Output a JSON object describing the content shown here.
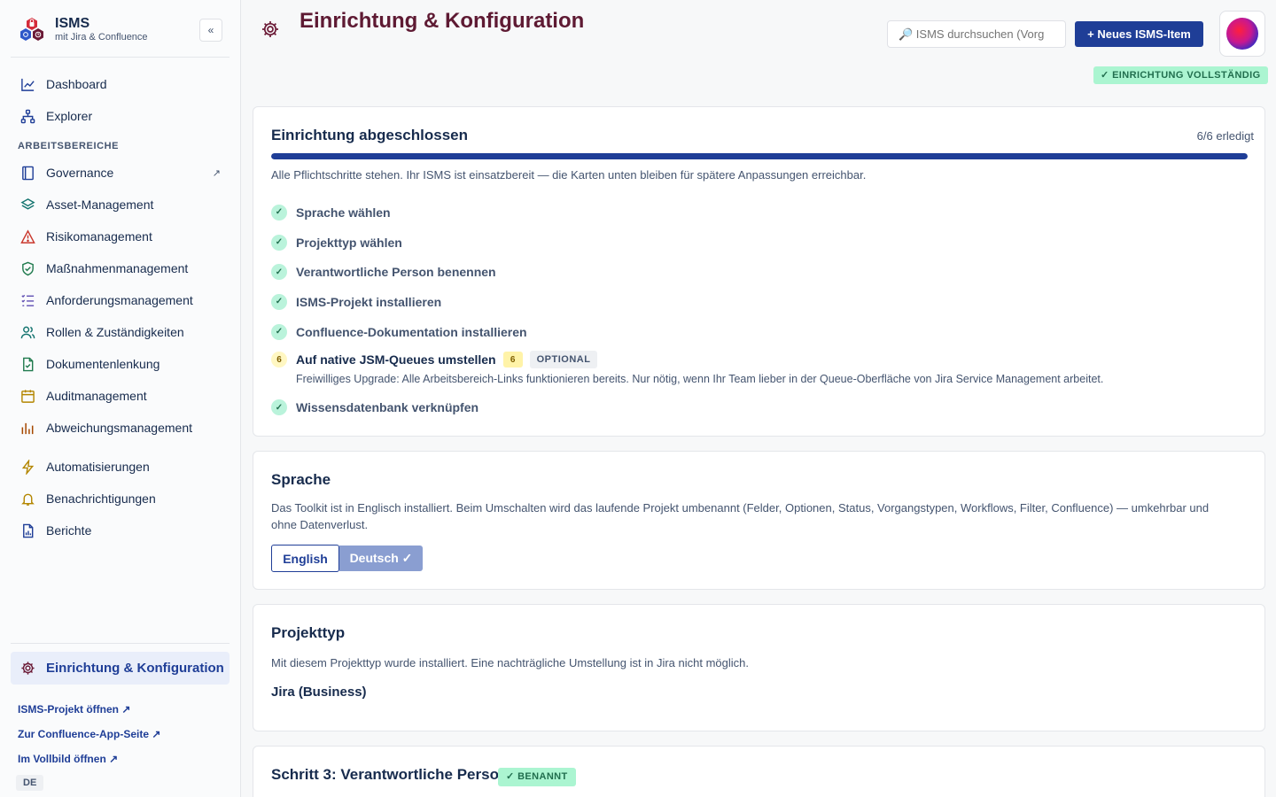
{
  "sidebar": {
    "brand_title": "ISMS",
    "brand_subtitle": "mit Jira & Confluence",
    "collapse_label": "«",
    "top_items": [
      {
        "label": "Dashboard",
        "icon": "chart-line-icon"
      },
      {
        "label": "Explorer",
        "icon": "hierarchy-icon"
      }
    ],
    "section_label": "ARBEITSBEREICHE",
    "items": [
      {
        "label": "Governance",
        "icon": "book-icon",
        "external": "↗"
      },
      {
        "label": "Asset-Management",
        "icon": "layers-icon"
      },
      {
        "label": "Risikomanagement",
        "icon": "warning-icon"
      },
      {
        "label": "Maßnahmenmanagement",
        "icon": "shield-check-icon"
      },
      {
        "label": "Anforderungsmanagement",
        "icon": "checklist-icon"
      },
      {
        "label": "Rollen & Zuständigkeiten",
        "icon": "users-icon"
      },
      {
        "label": "Dokumentenlenkung",
        "icon": "document-check-icon"
      },
      {
        "label": "Auditmanagement",
        "icon": "calendar-icon"
      },
      {
        "label": "Abweichungsmanagement",
        "icon": "bar-chart-icon"
      }
    ],
    "extra_items": [
      {
        "label": "Automatisierungen",
        "icon": "lightning-icon"
      },
      {
        "label": "Benachrichtigungen",
        "icon": "bell-icon"
      },
      {
        "label": "Berichte",
        "icon": "report-icon"
      }
    ],
    "active_item": {
      "label": "Einrichtung & Konfiguration",
      "icon": "gear-icon"
    },
    "links": [
      "ISMS-Projekt öffnen ↗",
      "Zur Confluence-App-Seite ↗",
      "Im Vollbild öffnen ↗"
    ],
    "language": "DE"
  },
  "header": {
    "title": "Einrichtung & Konfiguration",
    "search_placeholder": "🔎 ISMS durchsuchen (Vorg",
    "new_button": "+ Neues ISMS-Item",
    "status_badge": "✓ EINRICHTUNG VOLLSTÄNDIG"
  },
  "setup_card": {
    "title": "Einrichtung abgeschlossen",
    "count": "6/6 erledigt",
    "progress": 1.0,
    "description": "Alle Pflichtschritte stehen. Ihr ISMS ist einsatzbereit — die Karten unten bleiben für spätere Anpassungen erreichbar.",
    "steps": [
      {
        "label": "Sprache wählen",
        "mark": "✓"
      },
      {
        "label": "Projekttyp wählen",
        "mark": "✓"
      },
      {
        "label": "Verantwortliche Person benennen",
        "mark": "✓"
      },
      {
        "label": "ISMS-Projekt installieren",
        "mark": "✓"
      },
      {
        "label": "Confluence-Dokumentation installieren",
        "mark": "✓"
      }
    ],
    "optional_step": {
      "number": "6",
      "label": "Auf native JSM-Queues umstellen",
      "chip_number": "6",
      "chip_optional": "OPTIONAL",
      "description": "Freiwilliges Upgrade: Alle Arbeitsbereich-Links funktionieren bereits. Nur nötig, wenn Ihr Team lieber in der Queue-Oberfläche von Jira Service Management arbeitet."
    },
    "last_step": {
      "label": "Wissensdatenbank verknüpfen",
      "mark": "✓"
    }
  },
  "language_card": {
    "title": "Sprache",
    "description": "Das Toolkit ist in Englisch installiert. Beim Umschalten wird das laufende Projekt umbenannt (Felder, Optionen, Status, Vorgangstypen, Workflows, Filter, Confluence) — umkehrbar und ohne Datenverlust.",
    "option_en": "English",
    "option_de": "Deutsch ✓"
  },
  "project_type_card": {
    "title": "Projekttyp",
    "description": "Mit diesem Projekttyp wurde installiert. Eine nachträgliche Umstellung ist in Jira nicht möglich.",
    "value": "Jira (Business)"
  },
  "responsible_card": {
    "title": "Schritt 3: Verantwortliche Person",
    "badge": "✓ BENANNT"
  },
  "colors": {
    "accent": "#1f3e97",
    "title": "#5e1a33",
    "success_bg": "#abf5d1",
    "success_text": "#216e4e"
  }
}
